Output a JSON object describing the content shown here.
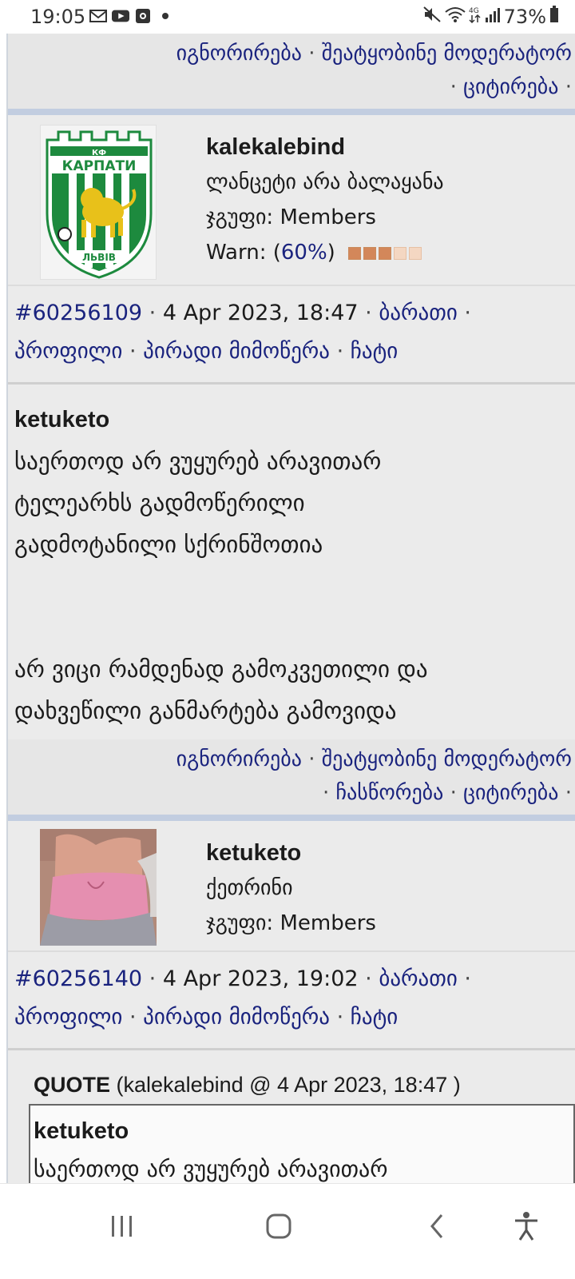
{
  "status_bar": {
    "time": "19:05",
    "battery": "73%",
    "left_icons": [
      "gmail-icon",
      "youtube-icon",
      "app-icon",
      "dot-icon"
    ],
    "right_icons": [
      "mute-icon",
      "wifi-icon",
      "4g-icon",
      "signal-icon",
      "battery-icon"
    ]
  },
  "top_actions": {
    "row1": [
      "იგნორირება",
      "შეატყობინე მოდერატორ"
    ],
    "row2": [
      "ციტირება"
    ]
  },
  "post1": {
    "username": "kalekalebind",
    "title": "ლანცეტი არა ბალაყანა",
    "group_label": "ჯგუფი:",
    "group_value": "Members",
    "warn_label": "Warn:",
    "warn_pct": "60%",
    "warn_level": 0.6,
    "post_id": "#60256109",
    "date": "4 Apr 2023, 18:47",
    "links": {
      "card": "ბარათი",
      "profile": "პროფილი",
      "pm": "პირადი მიმოწერა",
      "chat": "ჩატი"
    },
    "quoted_author": "ketuketo",
    "body": [
      "საერთოდ არ ვუყურებ არავითარ",
      "ტელეარხს გადმოწერილი",
      "გადმოტანილი სქრინშოთია"
    ],
    "body2": [
      "არ ვიცი რამდენად გამოკვეთილი და",
      "დახვეწილი განმარტება გამოვიდა"
    ],
    "actions_row1": [
      "იგნორირება",
      "შეატყობინე მოდერატორ"
    ],
    "actions_row2": [
      "ჩასწორება",
      "ციტირება"
    ]
  },
  "post2": {
    "username": "ketuketo",
    "title": "ქეთრინი",
    "group_label": "ჯგუფი:",
    "group_value": "Members",
    "post_id": "#60256140",
    "date": "4 Apr 2023, 19:02",
    "links": {
      "card": "ბარათი",
      "profile": "პროფილი",
      "pm": "პირადი მიმოწერა",
      "chat": "ჩატი"
    },
    "quote_label": "QUOTE",
    "quote_meta": "(kalekalebind @ 4 Apr 2023, 18:47 )",
    "quote_author": "ketuketo",
    "quote_first_line": "საერთოდ არ ვუყურებ არავითარ"
  },
  "nav_bar": [
    "recent-apps-icon",
    "home-icon",
    "back-icon",
    "accessibility-icon"
  ],
  "colors": {
    "link": "#1a237e",
    "post_bg": "#ebebeb",
    "divider": "#c2cde0"
  }
}
